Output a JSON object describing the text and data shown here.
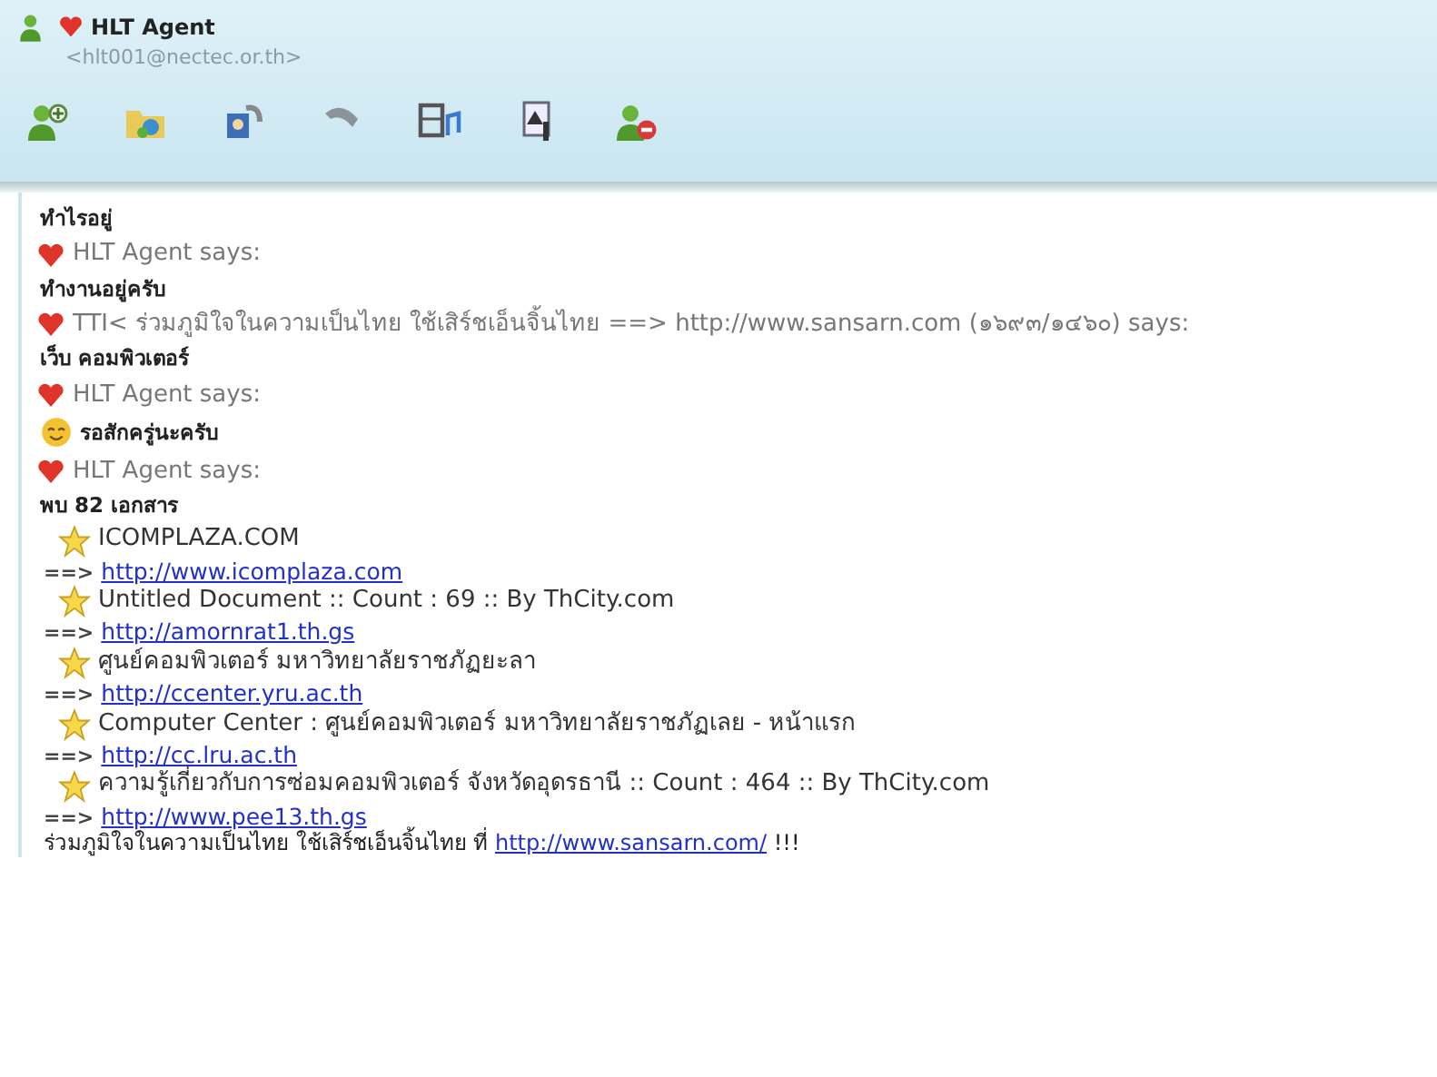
{
  "header": {
    "name": "HLT Agent",
    "email": "<hlt001@nectec.or.th>"
  },
  "toolbar": [
    {
      "kind": "invite"
    },
    {
      "kind": "share"
    },
    {
      "kind": "video"
    },
    {
      "kind": "call"
    },
    {
      "kind": "media"
    },
    {
      "kind": "games"
    },
    {
      "kind": "block"
    }
  ],
  "chat": [
    {
      "kind": "message",
      "text": "ทำไรอยู่"
    },
    {
      "kind": "sender",
      "name": "HLT Agent says:"
    },
    {
      "kind": "message",
      "text": "ทำงานอยู่ครับ"
    },
    {
      "kind": "sender",
      "name": "TTI< ร่วมภูมิใจในความเป็นไทย ใช้เสิร์ชเอ็นจิ้นไทย ==> http://www.sansarn.com  (๑๖๙๓/๑๔๖๐) says:"
    },
    {
      "kind": "message",
      "text": "เว็บ คอมพิวเตอร์"
    },
    {
      "kind": "sender",
      "name": "HLT Agent says:"
    },
    {
      "kind": "emoticon",
      "text": "รอสักครู่นะครับ"
    },
    {
      "kind": "sender",
      "name": "HLT Agent says:"
    },
    {
      "kind": "message",
      "text": "พบ 82 เอกสาร"
    },
    {
      "kind": "result",
      "title": "ICOMPLAZA.COM",
      "arrow": "==>",
      "url": "http://www.icomplaza.com"
    },
    {
      "kind": "result",
      "title": "Untitled Document :: Count : 69 :: By ThCity.com",
      "arrow": "==>",
      "url": "http://amornrat1.th.gs"
    },
    {
      "kind": "result",
      "title": "ศูนย์คอมพิวเตอร์ มหาวิทยาลัยราชภัฏยะลา",
      "arrow": "==>",
      "url": "http://ccenter.yru.ac.th"
    },
    {
      "kind": "result",
      "title": "Computer Center : ศูนย์คอมพิวเตอร์ มหาวิทยาลัยราชภัฏเลย - หน้าแรก",
      "arrow": "==>",
      "url": "http://cc.lru.ac.th"
    },
    {
      "kind": "result",
      "title": "ความรู้เกี่ยวกับการซ่อมคอมพิวเตอร์ จังหวัดอุดรธานี :: Count : 464 :: By ThCity.com",
      "arrow": "==>",
      "url": "http://www.pee13.th.gs"
    },
    {
      "kind": "footer",
      "text": "ร่วมภูมิใจในความเป็นไทย ใช้เสิร์ชเอ็นจิ้นไทย  ที่",
      "url": "http://www.sansarn.com/",
      "tail": "!!!"
    }
  ]
}
